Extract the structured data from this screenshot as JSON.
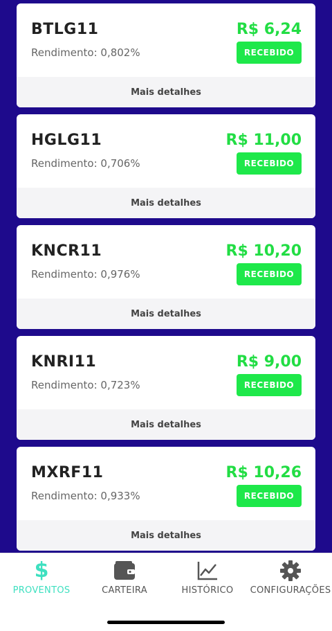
{
  "proventos": [
    {
      "ticker": "BTLG11",
      "yield": "Rendimento: 0,802%",
      "amount": "R$ 6,24",
      "status": "RECEBIDO",
      "details": "Mais detalhes"
    },
    {
      "ticker": "HGLG11",
      "yield": "Rendimento: 0,706%",
      "amount": "R$ 11,00",
      "status": "RECEBIDO",
      "details": "Mais detalhes"
    },
    {
      "ticker": "KNCR11",
      "yield": "Rendimento: 0,976%",
      "amount": "R$ 10,20",
      "status": "RECEBIDO",
      "details": "Mais detalhes"
    },
    {
      "ticker": "KNRI11",
      "yield": "Rendimento: 0,723%",
      "amount": "R$ 9,00",
      "status": "RECEBIDO",
      "details": "Mais detalhes"
    },
    {
      "ticker": "MXRF11",
      "yield": "Rendimento: 0,933%",
      "amount": "R$ 10,26",
      "status": "RECEBIDO",
      "details": "Mais detalhes"
    }
  ],
  "tabbar": {
    "tabs": [
      {
        "label": "PROVENTOS",
        "icon": "dollar-icon",
        "active": true
      },
      {
        "label": "CARTEIRA",
        "icon": "wallet-icon",
        "active": false
      },
      {
        "label": "HISTÓRICO",
        "icon": "chart-line-icon",
        "active": false
      },
      {
        "label": "CONFIGURAÇÕES",
        "icon": "gear-icon",
        "active": false
      }
    ]
  },
  "colors": {
    "background": "#1e0a8c",
    "amount": "#22dd44",
    "badge": "#1ee84a",
    "active_tab": "#3ee0c0",
    "inactive_tab": "#555555"
  }
}
